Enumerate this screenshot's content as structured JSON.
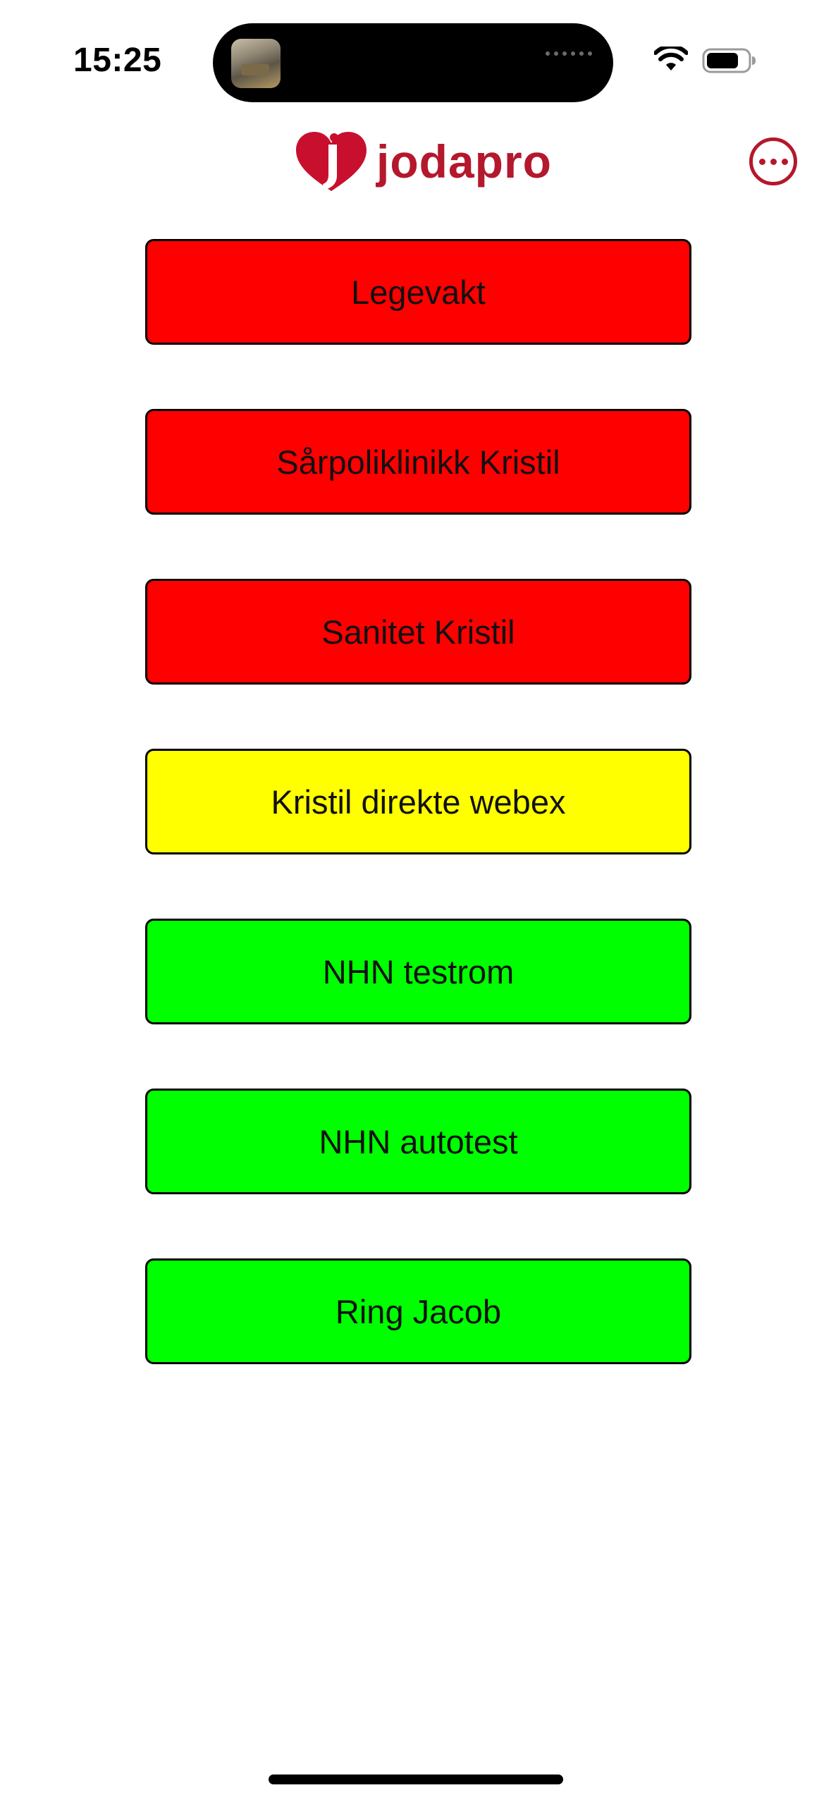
{
  "status_bar": {
    "time": "15:25"
  },
  "header": {
    "logo_text": "jodapro",
    "brand_color": "#b4182c",
    "menu_icon": "ellipsis-circle-icon"
  },
  "buttons": [
    {
      "label": "Legevakt",
      "color": "#ff0000"
    },
    {
      "label": "Sårpoliklinikk Kristil",
      "color": "#ff0000"
    },
    {
      "label": "Sanitet Kristil",
      "color": "#ff0000"
    },
    {
      "label": "Kristil direkte webex",
      "color": "#ffff00"
    },
    {
      "label": "NHN testrom",
      "color": "#00ff00"
    },
    {
      "label": "NHN autotest",
      "color": "#00ff00"
    },
    {
      "label": "Ring Jacob",
      "color": "#00ff00"
    }
  ]
}
